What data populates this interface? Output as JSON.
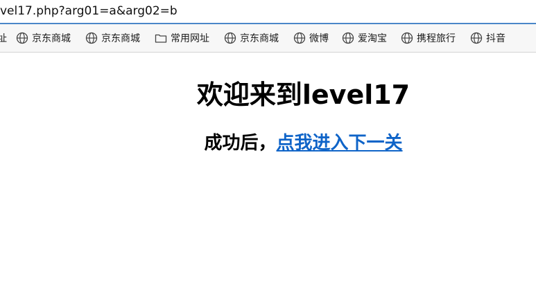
{
  "address_bar": {
    "url": "vel17.php?arg01=a&arg02=b"
  },
  "bookmarks": [
    {
      "label": "址",
      "icon": "none"
    },
    {
      "label": "京东商城",
      "icon": "globe-icon"
    },
    {
      "label": "京东商城",
      "icon": "globe-icon"
    },
    {
      "label": "常用网址",
      "icon": "folder-icon"
    },
    {
      "label": "京东商城",
      "icon": "globe-icon"
    },
    {
      "label": "微博",
      "icon": "globe-icon"
    },
    {
      "label": "爱淘宝",
      "icon": "globe-icon"
    },
    {
      "label": "携程旅行",
      "icon": "globe-icon"
    },
    {
      "label": "抖音",
      "icon": "globe-icon"
    }
  ],
  "page": {
    "heading": "欢迎来到level17",
    "subheading_prefix": "成功后，",
    "next_link": "点我进入下一关"
  },
  "colors": {
    "link": "#0f64c8",
    "address_border": "#4a86c8",
    "bookmark_bar_bg": "#f7f7f7"
  }
}
